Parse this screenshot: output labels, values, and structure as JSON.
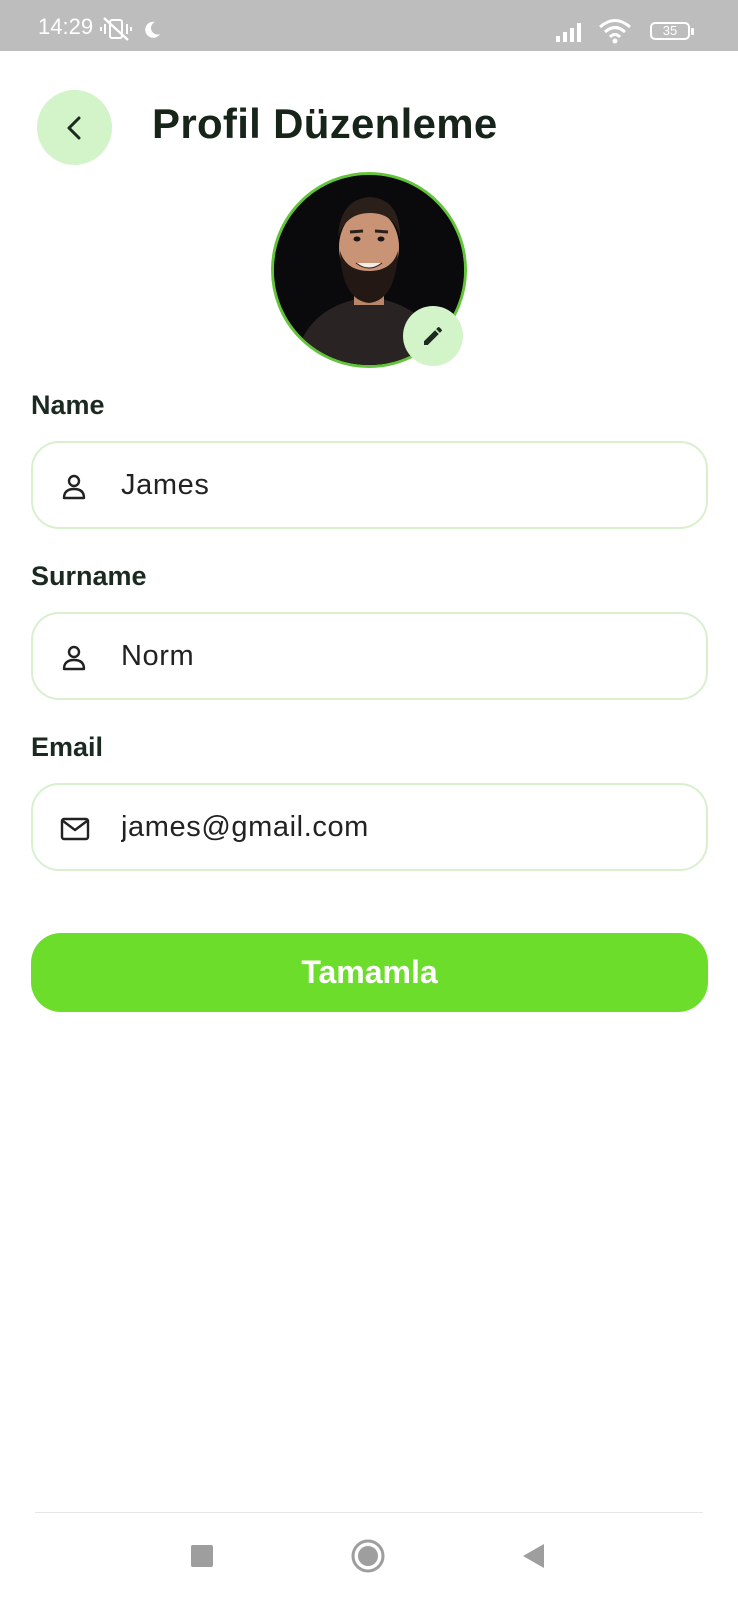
{
  "status_bar": {
    "time": "14:29",
    "battery": "35"
  },
  "header": {
    "title": "Profil Düzenleme"
  },
  "form": {
    "name_label": "Name",
    "name_value": "James",
    "surname_label": "Surname",
    "surname_value": "Norm",
    "email_label": "Email",
    "email_value": "james@gmail.com"
  },
  "actions": {
    "submit_label": "Tamamla"
  },
  "icons": {
    "back": "chevron-left-icon",
    "edit": "pencil-icon",
    "name": "person-icon",
    "surname": "person-icon",
    "email": "mail-icon",
    "nav": [
      "square-icon",
      "circle-icon",
      "triangle-back-icon"
    ]
  },
  "colors": {
    "accent": "#6ddd2b",
    "accent_light": "#d3f3c9",
    "field_border": "#d8f0cd",
    "avatar_ring": "#63c33a",
    "status_bar": "#bdbdbd"
  }
}
